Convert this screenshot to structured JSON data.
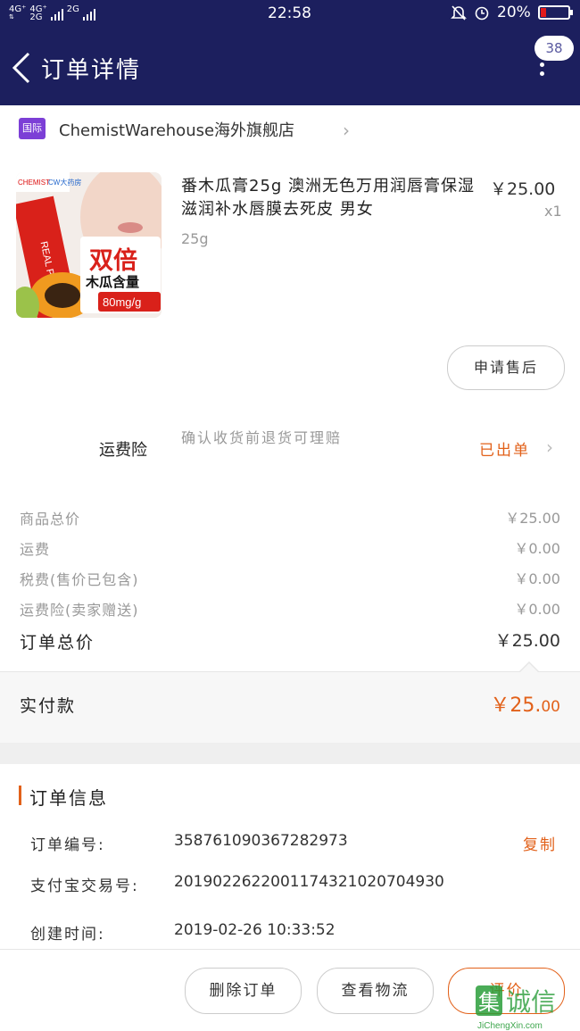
{
  "status_bar": {
    "network_1": "4G⁺",
    "network_2": "4G⁺",
    "network_3": "2G",
    "network_4": "2G",
    "time": "22:58",
    "battery": "20%",
    "battery_color": "#e21b1b"
  },
  "nav": {
    "title": "订单详情",
    "badge": "38",
    "bg_color": "#1c1f5e"
  },
  "store": {
    "tag": "国际",
    "name": "ChemistWarehouse海外旗舰店"
  },
  "product": {
    "title": "番木瓜膏25g 澳洲无色万用润唇膏保湿滋润补水唇膜去死皮 男女",
    "spec": "25g",
    "price": "￥25.00",
    "qty": "x1",
    "image": {
      "brand_tag": "CHEMIST",
      "store_tag": "CW大药房",
      "tube_text": "REAL PAW PAW",
      "headline": "双倍",
      "subline": "木瓜含量",
      "dose": "80mg/g"
    },
    "after_sale_label": "申请售后"
  },
  "insurance": {
    "label": "运费险",
    "desc": "确认收货前退货可理赔",
    "status": "已出单"
  },
  "summary": {
    "rows": [
      {
        "label": "商品总价",
        "value": "￥25.00"
      },
      {
        "label": "运费",
        "value": "￥0.00"
      },
      {
        "label": "税费(售价已包含)",
        "value": "￥0.00"
      },
      {
        "label": "运费险(卖家赠送)",
        "value": "￥0.00"
      }
    ],
    "total_label": "订单总价",
    "total_value": "￥25.00",
    "paid_label": "实付款",
    "paid_value_main": "￥25.",
    "paid_value_cents": "00",
    "accent_color": "#e2611a"
  },
  "order_info": {
    "title": "订单信息",
    "order_no_label": "订单编号:",
    "order_no": "358761090367282973",
    "copy_label": "复制",
    "alipay_label": "支付宝交易号:",
    "alipay_no": "2019022622001174321020704930",
    "created_label": "创建时间:",
    "created_time": "2019-02-26 10:33:52"
  },
  "actions": {
    "delete": "删除订单",
    "logistics": "查看物流",
    "review": "评价"
  },
  "watermark": {
    "text": "诚信",
    "sub": "JiChengXin.com"
  }
}
